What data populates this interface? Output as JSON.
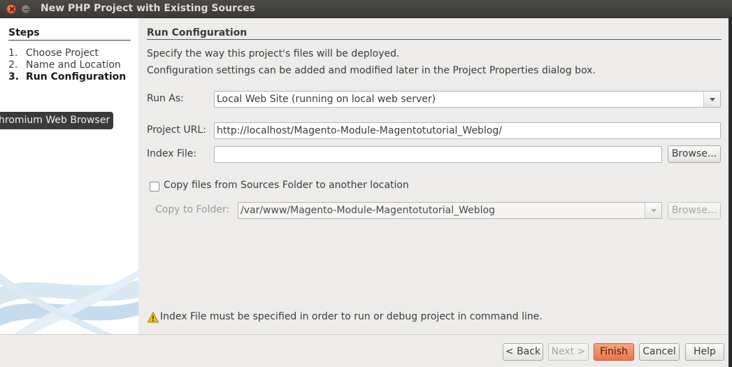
{
  "window": {
    "title": "New PHP Project with Existing Sources"
  },
  "steps": {
    "title": "Steps",
    "items": [
      {
        "num": "1.",
        "label": "Choose Project"
      },
      {
        "num": "2.",
        "label": "Name and Location"
      },
      {
        "num": "3.",
        "label": "Run Configuration"
      }
    ],
    "active_index": 2
  },
  "tooltip": {
    "text": "hromium Web Browser"
  },
  "main": {
    "section_title": "Run Configuration",
    "description_line1": "Specify the way this project's files will be deployed.",
    "description_line2": "Configuration settings can be added and modified later in the Project Properties dialog box.",
    "run_as": {
      "label": "Run As:",
      "value": "Local Web Site (running on local web server)"
    },
    "project_url": {
      "label": "Project URL:",
      "value": "http://localhost/Magento-Module-Magentotutorial_Weblog/"
    },
    "index_file": {
      "label": "Index File:",
      "value": "",
      "browse_label": "Browse..."
    },
    "copy_files": {
      "label": "Copy files from Sources Folder to another location",
      "checked": false
    },
    "copy_to_folder": {
      "label": "Copy to Folder:",
      "value": "/var/www/Magento-Module-Magentotutorial_Weblog",
      "browse_label": "Browse..."
    },
    "warning": {
      "icon": "warning-icon",
      "text": "Index File must be specified in order to run or debug project in command line."
    }
  },
  "footer": {
    "back_label": "< Back",
    "next_label": "Next >",
    "finish_label": "Finish",
    "cancel_label": "Cancel",
    "help_label": "Help"
  },
  "colors": {
    "accent": "#ea7448",
    "titlebar": "#3c3b37",
    "dialog_bg": "#edecea",
    "warning": "#e8b90f"
  }
}
